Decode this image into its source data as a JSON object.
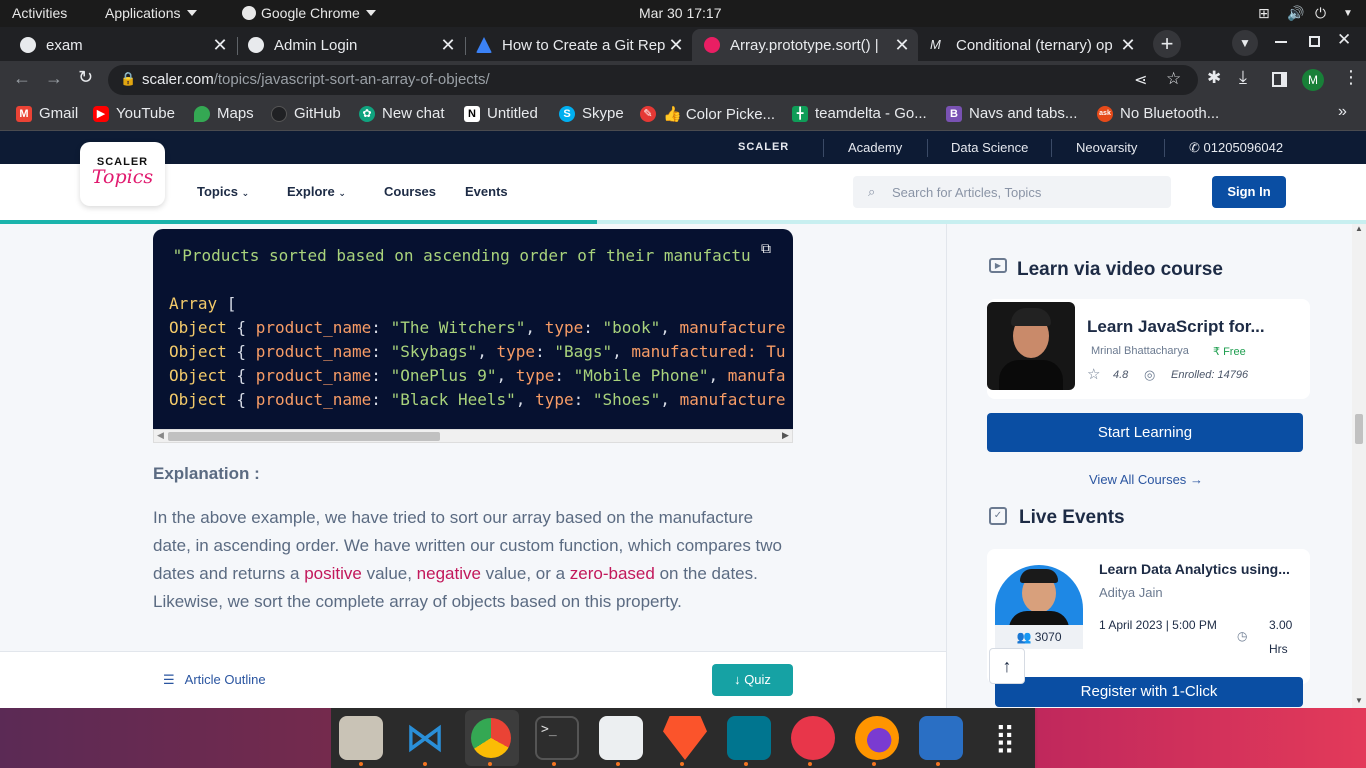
{
  "topbar": {
    "activities": "Activities",
    "applications": "Applications",
    "app_name": "Google Chrome",
    "clock": "Mar 30  17:17"
  },
  "tabs": [
    {
      "title": "exam"
    },
    {
      "title": "Admin Login"
    },
    {
      "title": "How to Create a Git Rep"
    },
    {
      "title": "Array.prototype.sort() |"
    },
    {
      "title": "Conditional (ternary) op"
    }
  ],
  "omnibox": {
    "host": "scaler.com",
    "path": "/topics/javascript-sort-an-array-of-objects/"
  },
  "profile_initial": "M",
  "bookmarks": [
    {
      "label": "Gmail"
    },
    {
      "label": "YouTube"
    },
    {
      "label": "Maps"
    },
    {
      "label": "GitHub"
    },
    {
      "label": "New chat"
    },
    {
      "label": "Untitled"
    },
    {
      "label": "Skype"
    },
    {
      "label": "👍 Color Picke..."
    },
    {
      "label": "teamdelta - Go..."
    },
    {
      "label": "Navs and tabs..."
    },
    {
      "label": "No Bluetooth..."
    }
  ],
  "scaler_bar": {
    "brand": "SCALER",
    "links": [
      "Academy",
      "Data Science",
      "Neovarsity"
    ],
    "phone": "01205096042"
  },
  "logo": {
    "line1": "SCALER",
    "line2": "Topics"
  },
  "nav": {
    "topics": "Topics",
    "explore": "Explore",
    "courses": "Courses",
    "events": "Events",
    "search_placeholder": "Search for Articles, Topics",
    "signin": "Sign In"
  },
  "reading_progress": 0.437,
  "code": {
    "line0": " \"Products sorted based on ascending order of their manufactu",
    "array_kw": "Array",
    "array_open": " [",
    "rows": [
      {
        "name": "\"The Witchers\"",
        "type": "\"book\"",
        "tail": "manufacture"
      },
      {
        "name": "\"Skybags\"",
        "type": "\"Bags\"",
        "tail": "manufactured: Tu"
      },
      {
        "name": "\"OnePlus 9\"",
        "type": "\"Mobile Phone\"",
        "tail": "manufa"
      },
      {
        "name": "\"Black Heels\"",
        "type": "\"Shoes\"",
        "tail": "manufacture"
      }
    ],
    "obj_kw": "Object",
    "obj_open": " { ",
    "prop_name": "product_name",
    "prop_type": "type"
  },
  "explanation": {
    "heading": "Explanation :",
    "p1": "In the above example, we have tried to sort our array based on the manufacture date, in ascending order. We have written our custom function, which compares two dates and returns a ",
    "hl1": "positive",
    "p2": " value, ",
    "hl2": "negative",
    "p3": " value, or a ",
    "hl3": "zero-based",
    "p4": " on the dates. Likewise, we sort the complete array of objects based on this property."
  },
  "bottom": {
    "outline": "Article Outline",
    "quiz": "Quiz"
  },
  "sidebar": {
    "video_heading": "Learn via video course",
    "course": {
      "title": "Learn JavaScript for...",
      "instructor": "Mrinal Bhattacharya",
      "price": "Free",
      "rating": "4.8",
      "enrolled": "Enrolled: 14796",
      "cta": "Start Learning"
    },
    "view_all": "View All Courses",
    "events_heading": "Live Events",
    "event": {
      "title": "Learn Data Analytics using...",
      "host": "Aditya Jain",
      "date": "1 April 2023 | 5:00 PM",
      "duration": "3.00 Hrs",
      "attendees": "3070",
      "cta": "Register with 1-Click"
    }
  },
  "colors": {
    "accent": "#0a4ea3",
    "teal": "#16a2a4",
    "highlight": "#c2185b",
    "code_bg": "#061130"
  }
}
